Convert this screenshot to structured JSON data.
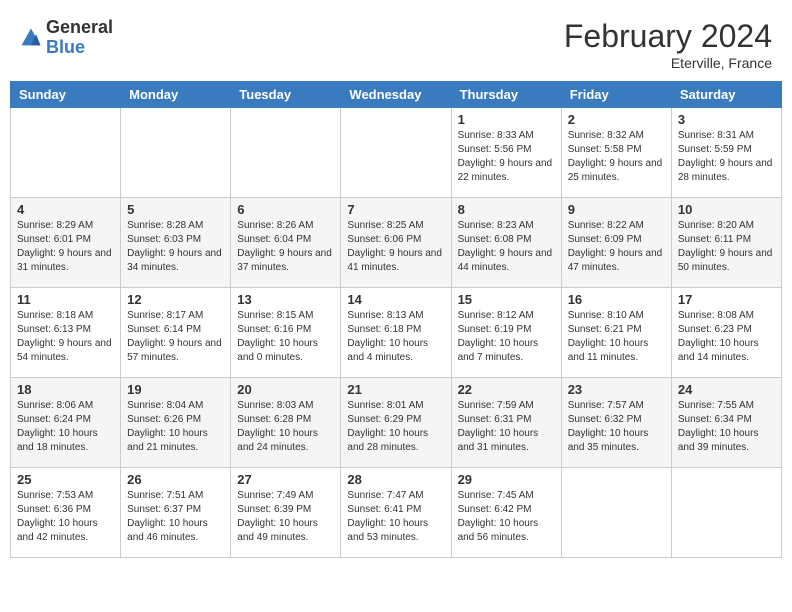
{
  "header": {
    "logo_general": "General",
    "logo_blue": "Blue",
    "month_year": "February 2024",
    "location": "Eterville, France"
  },
  "days_of_week": [
    "Sunday",
    "Monday",
    "Tuesday",
    "Wednesday",
    "Thursday",
    "Friday",
    "Saturday"
  ],
  "weeks": [
    [
      {
        "day": "",
        "info": ""
      },
      {
        "day": "",
        "info": ""
      },
      {
        "day": "",
        "info": ""
      },
      {
        "day": "",
        "info": ""
      },
      {
        "day": "1",
        "info": "Sunrise: 8:33 AM\nSunset: 5:56 PM\nDaylight: 9 hours and 22 minutes."
      },
      {
        "day": "2",
        "info": "Sunrise: 8:32 AM\nSunset: 5:58 PM\nDaylight: 9 hours and 25 minutes."
      },
      {
        "day": "3",
        "info": "Sunrise: 8:31 AM\nSunset: 5:59 PM\nDaylight: 9 hours and 28 minutes."
      }
    ],
    [
      {
        "day": "4",
        "info": "Sunrise: 8:29 AM\nSunset: 6:01 PM\nDaylight: 9 hours and 31 minutes."
      },
      {
        "day": "5",
        "info": "Sunrise: 8:28 AM\nSunset: 6:03 PM\nDaylight: 9 hours and 34 minutes."
      },
      {
        "day": "6",
        "info": "Sunrise: 8:26 AM\nSunset: 6:04 PM\nDaylight: 9 hours and 37 minutes."
      },
      {
        "day": "7",
        "info": "Sunrise: 8:25 AM\nSunset: 6:06 PM\nDaylight: 9 hours and 41 minutes."
      },
      {
        "day": "8",
        "info": "Sunrise: 8:23 AM\nSunset: 6:08 PM\nDaylight: 9 hours and 44 minutes."
      },
      {
        "day": "9",
        "info": "Sunrise: 8:22 AM\nSunset: 6:09 PM\nDaylight: 9 hours and 47 minutes."
      },
      {
        "day": "10",
        "info": "Sunrise: 8:20 AM\nSunset: 6:11 PM\nDaylight: 9 hours and 50 minutes."
      }
    ],
    [
      {
        "day": "11",
        "info": "Sunrise: 8:18 AM\nSunset: 6:13 PM\nDaylight: 9 hours and 54 minutes."
      },
      {
        "day": "12",
        "info": "Sunrise: 8:17 AM\nSunset: 6:14 PM\nDaylight: 9 hours and 57 minutes."
      },
      {
        "day": "13",
        "info": "Sunrise: 8:15 AM\nSunset: 6:16 PM\nDaylight: 10 hours and 0 minutes."
      },
      {
        "day": "14",
        "info": "Sunrise: 8:13 AM\nSunset: 6:18 PM\nDaylight: 10 hours and 4 minutes."
      },
      {
        "day": "15",
        "info": "Sunrise: 8:12 AM\nSunset: 6:19 PM\nDaylight: 10 hours and 7 minutes."
      },
      {
        "day": "16",
        "info": "Sunrise: 8:10 AM\nSunset: 6:21 PM\nDaylight: 10 hours and 11 minutes."
      },
      {
        "day": "17",
        "info": "Sunrise: 8:08 AM\nSunset: 6:23 PM\nDaylight: 10 hours and 14 minutes."
      }
    ],
    [
      {
        "day": "18",
        "info": "Sunrise: 8:06 AM\nSunset: 6:24 PM\nDaylight: 10 hours and 18 minutes."
      },
      {
        "day": "19",
        "info": "Sunrise: 8:04 AM\nSunset: 6:26 PM\nDaylight: 10 hours and 21 minutes."
      },
      {
        "day": "20",
        "info": "Sunrise: 8:03 AM\nSunset: 6:28 PM\nDaylight: 10 hours and 24 minutes."
      },
      {
        "day": "21",
        "info": "Sunrise: 8:01 AM\nSunset: 6:29 PM\nDaylight: 10 hours and 28 minutes."
      },
      {
        "day": "22",
        "info": "Sunrise: 7:59 AM\nSunset: 6:31 PM\nDaylight: 10 hours and 31 minutes."
      },
      {
        "day": "23",
        "info": "Sunrise: 7:57 AM\nSunset: 6:32 PM\nDaylight: 10 hours and 35 minutes."
      },
      {
        "day": "24",
        "info": "Sunrise: 7:55 AM\nSunset: 6:34 PM\nDaylight: 10 hours and 39 minutes."
      }
    ],
    [
      {
        "day": "25",
        "info": "Sunrise: 7:53 AM\nSunset: 6:36 PM\nDaylight: 10 hours and 42 minutes."
      },
      {
        "day": "26",
        "info": "Sunrise: 7:51 AM\nSunset: 6:37 PM\nDaylight: 10 hours and 46 minutes."
      },
      {
        "day": "27",
        "info": "Sunrise: 7:49 AM\nSunset: 6:39 PM\nDaylight: 10 hours and 49 minutes."
      },
      {
        "day": "28",
        "info": "Sunrise: 7:47 AM\nSunset: 6:41 PM\nDaylight: 10 hours and 53 minutes."
      },
      {
        "day": "29",
        "info": "Sunrise: 7:45 AM\nSunset: 6:42 PM\nDaylight: 10 hours and 56 minutes."
      },
      {
        "day": "",
        "info": ""
      },
      {
        "day": "",
        "info": ""
      }
    ]
  ]
}
